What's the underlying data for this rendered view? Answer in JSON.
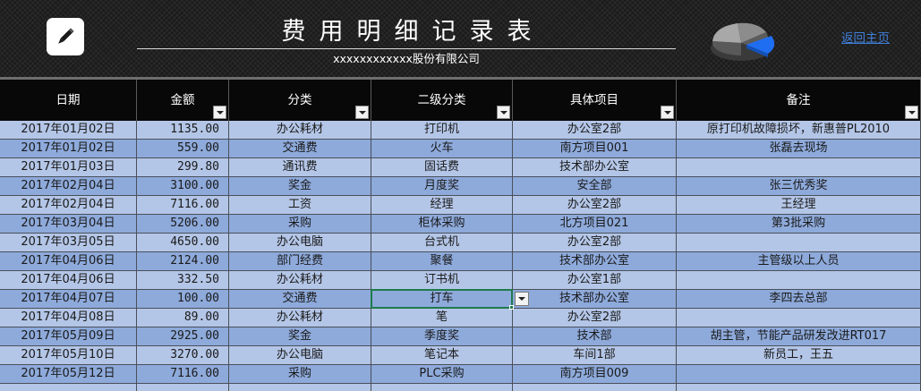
{
  "header": {
    "title": "费用明细记录表",
    "subtitle": "xxxxxxxxxxxx股份有限公司",
    "home_link": "返回主页",
    "edit_icon": "pencil-icon",
    "chart_icon": "pie-chart-icon",
    "colors": {
      "banner": "#1c1c1c",
      "link": "#3f7fd9",
      "pie_accent": "#1f6ef2"
    }
  },
  "table": {
    "columns": [
      "日期",
      "金额",
      "分类",
      "二级分类",
      "具体项目",
      "备注"
    ],
    "filter_icon": "dropdown-arrow-icon",
    "rows": [
      [
        "2017年01月02日",
        "1135.00",
        "办公耗材",
        "打印机",
        "办公室2部",
        "原打印机故障损坏，新惠普PL2010"
      ],
      [
        "2017年01月02日",
        "559.00",
        "交通费",
        "火车",
        "南方项目001",
        "张磊去现场"
      ],
      [
        "2017年01月03日",
        "299.80",
        "通讯费",
        "固话费",
        "技术部办公室",
        ""
      ],
      [
        "2017年02月04日",
        "3100.00",
        "奖金",
        "月度奖",
        "安全部",
        "张三优秀奖"
      ],
      [
        "2017年02月04日",
        "7116.00",
        "工资",
        "经理",
        "办公室2部",
        "王经理"
      ],
      [
        "2017年03月04日",
        "5206.00",
        "采购",
        "柜体采购",
        "北方项目021",
        "第3批采购"
      ],
      [
        "2017年03月05日",
        "4650.00",
        "办公电脑",
        "台式机",
        "办公室2部",
        ""
      ],
      [
        "2017年04月06日",
        "2124.00",
        "部门经费",
        "聚餐",
        "技术部办公室",
        "主管级以上人员"
      ],
      [
        "2017年04月06日",
        "332.50",
        "办公耗材",
        "订书机",
        "办公室1部",
        ""
      ],
      [
        "2017年04月07日",
        "100.00",
        "交通费",
        "打车",
        "技术部办公室",
        "李四去总部"
      ],
      [
        "2017年04月08日",
        "89.00",
        "办公耗材",
        "笔",
        "办公室2部",
        ""
      ],
      [
        "2017年05月09日",
        "2925.00",
        "奖金",
        "季度奖",
        "技术部",
        "胡主管，节能产品研发改进RT017"
      ],
      [
        "2017年05月10日",
        "3270.00",
        "办公电脑",
        "笔记本",
        "车间1部",
        "新员工，王五"
      ],
      [
        "2017年05月12日",
        "7116.00",
        "采购",
        "PLC采购",
        "南方项目009",
        ""
      ],
      [
        "",
        "",
        "",
        "",
        "",
        ""
      ]
    ],
    "selected": {
      "row": 9,
      "col": 3
    },
    "colors": {
      "header_bg": "#080808",
      "row_light": "#b4c6e7",
      "row_dark": "#8eaadb",
      "selection": "#1f7a4c"
    }
  }
}
